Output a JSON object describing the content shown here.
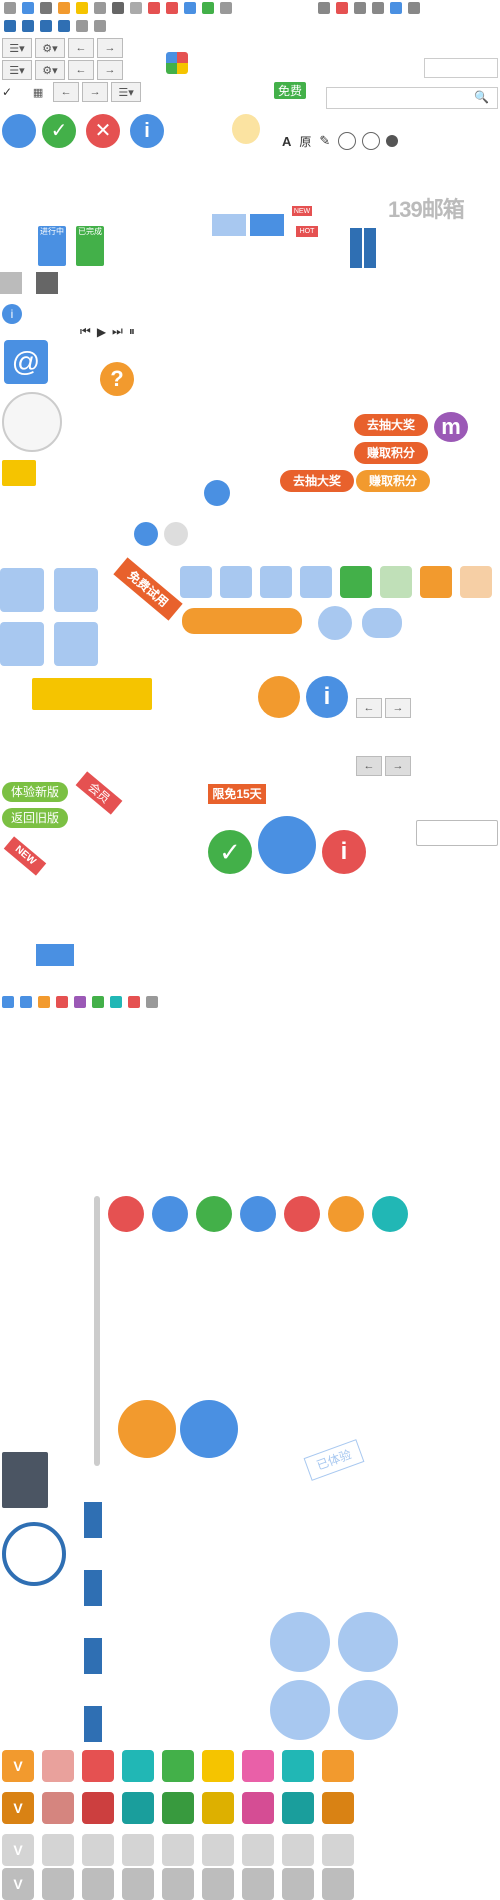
{
  "labels": {
    "free": "免费",
    "free_trial": "免费试用",
    "brand": "139邮箱",
    "in_progress": "进行中",
    "done": "已完成",
    "lucky_draw": "去抽大奖",
    "earn_points": "赚取积分",
    "try_new": "体验新版",
    "back_old": "返回旧版",
    "member": "会员",
    "new_tag": "NEW",
    "free_15": "限免15天",
    "hot": "HOT",
    "experienced": "已体验",
    "a_letter": "A",
    "v_letter": "V",
    "original": "原",
    "m_letter": "m",
    "at_symbol": "@",
    "qmark": "?",
    "info": "i",
    "check": "✓",
    "cross": "✕",
    "search": "🔍"
  },
  "colors": {
    "blue": "#4a90e2",
    "green": "#43b049",
    "red": "#e55151",
    "orange": "#f29a2e",
    "yellow": "#f5c400",
    "purple": "#9b59b6",
    "teal": "#21b7b5",
    "light_blue": "#a8c8f0",
    "gray": "#bbbbbb"
  }
}
